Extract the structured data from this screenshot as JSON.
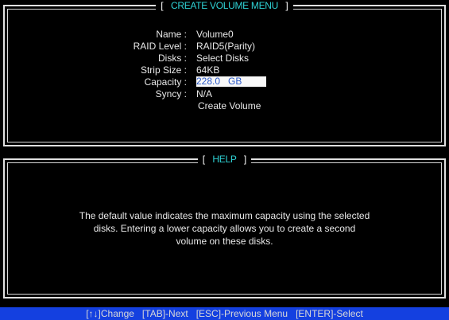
{
  "create_menu": {
    "title": "CREATE VOLUME MENU",
    "fields": [
      {
        "label": "Name :",
        "value": "Volume0"
      },
      {
        "label": "RAID Level :",
        "value": "RAID5(Parity)"
      },
      {
        "label": "Disks :",
        "value": "Select Disks"
      },
      {
        "label": "Strip Size :",
        "value": "64KB"
      },
      {
        "label": "Capacity :",
        "value": "228.0   GB"
      },
      {
        "label": "Syncy :",
        "value": "N/A"
      }
    ],
    "create_label": "Create Volume"
  },
  "help": {
    "title": "HELP",
    "lines": [
      "The default value indicates the maximum  capacity using the selected",
      "disks.  Entering a lower capacity allows you to create a second",
      "volume on these disks."
    ]
  },
  "statusbar": {
    "text": "[↑↓]Change   [TAB]-Next   [ESC]-Previous Menu   [ENTER]-Select"
  },
  "colors": {
    "title_accent": "#2fd3d6",
    "statusbar_bg": "#1440e0",
    "highlight_text": "#2a58c8"
  }
}
